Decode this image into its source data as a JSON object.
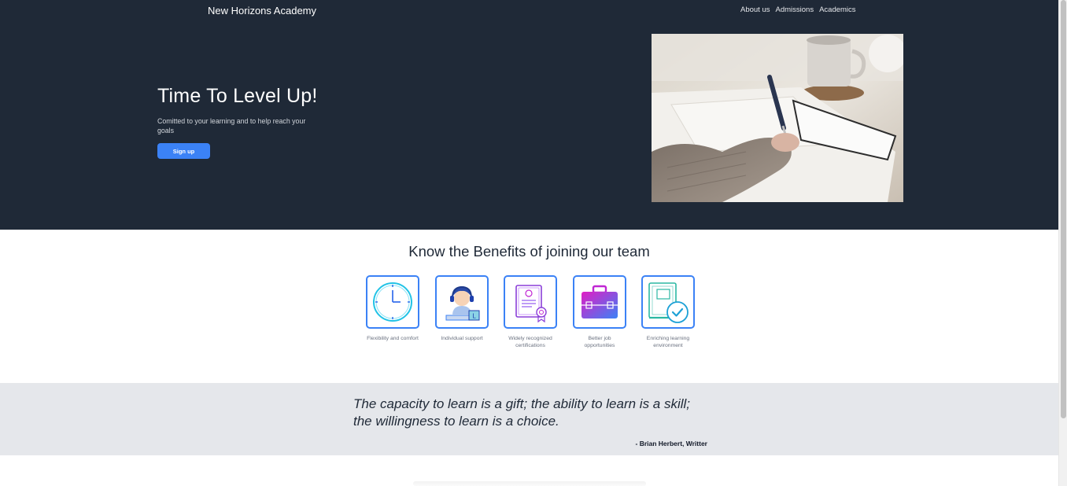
{
  "header": {
    "brand": "New Horizons Academy",
    "nav": [
      "About us",
      "Admissions",
      "Academics"
    ]
  },
  "hero": {
    "title": "Time To Level Up!",
    "subtitle": "Comitted to your learning and to help reach your goals",
    "cta_label": "Sign up",
    "image": "person-writing-on-paper-photo"
  },
  "benefits": {
    "title": "Know the Benefits of joining our team",
    "items": [
      {
        "icon": "clock-icon",
        "label": "Flexibility and comfort"
      },
      {
        "icon": "support-agent-icon",
        "label": "Individual support"
      },
      {
        "icon": "certificate-icon",
        "label": "Widely recognized certifications"
      },
      {
        "icon": "briefcase-icon",
        "label": "Better job opportunities"
      },
      {
        "icon": "book-check-icon",
        "label": "Enriching learning environment"
      }
    ]
  },
  "quote": {
    "text": "The capacity to learn is a gift; the ability to learn is a skill; the willingness to learn is a choice.",
    "author": "- Brian Herbert, Writter"
  },
  "colors": {
    "hero_bg": "#1f2937",
    "accent": "#3b82f6",
    "quote_bg": "#e5e7eb"
  }
}
